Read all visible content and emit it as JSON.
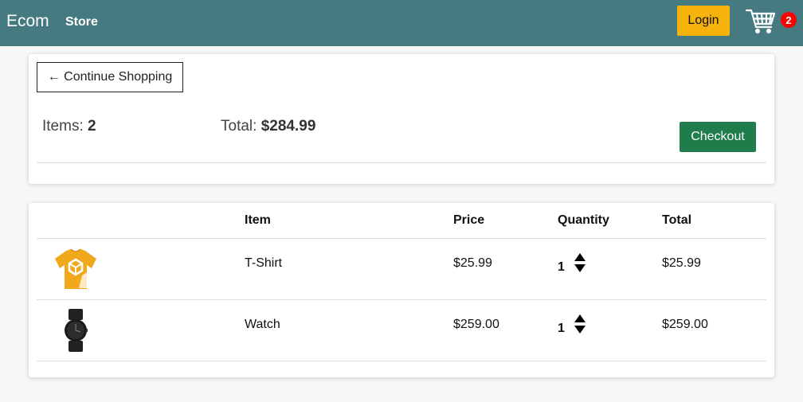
{
  "navbar": {
    "brand": "Ecom",
    "store_link": "Store",
    "login_label": "Login",
    "cart_icon": "cart-icon",
    "cart_count": "2",
    "background": "#457a80",
    "login_color": "#f5b30b",
    "badge_color": "#ff0000"
  },
  "summary": {
    "continue_label": "← Continue Shopping",
    "items_label": "Items:",
    "items_value": "2",
    "total_label": "Total:",
    "total_value": "$284.99",
    "checkout_label": "Checkout",
    "checkout_color": "#1e7d4a"
  },
  "table": {
    "headers": [
      "Item",
      "Price",
      "Quantity",
      "Total"
    ],
    "rows": [
      {
        "image_icon": "tshirt-image",
        "name": "T-Shirt",
        "price": "$25.99",
        "quantity": "1",
        "total": "$25.99"
      },
      {
        "image_icon": "watch-image",
        "name": "Watch",
        "price": "$259.00",
        "quantity": "1",
        "total": "$259.00"
      }
    ]
  }
}
